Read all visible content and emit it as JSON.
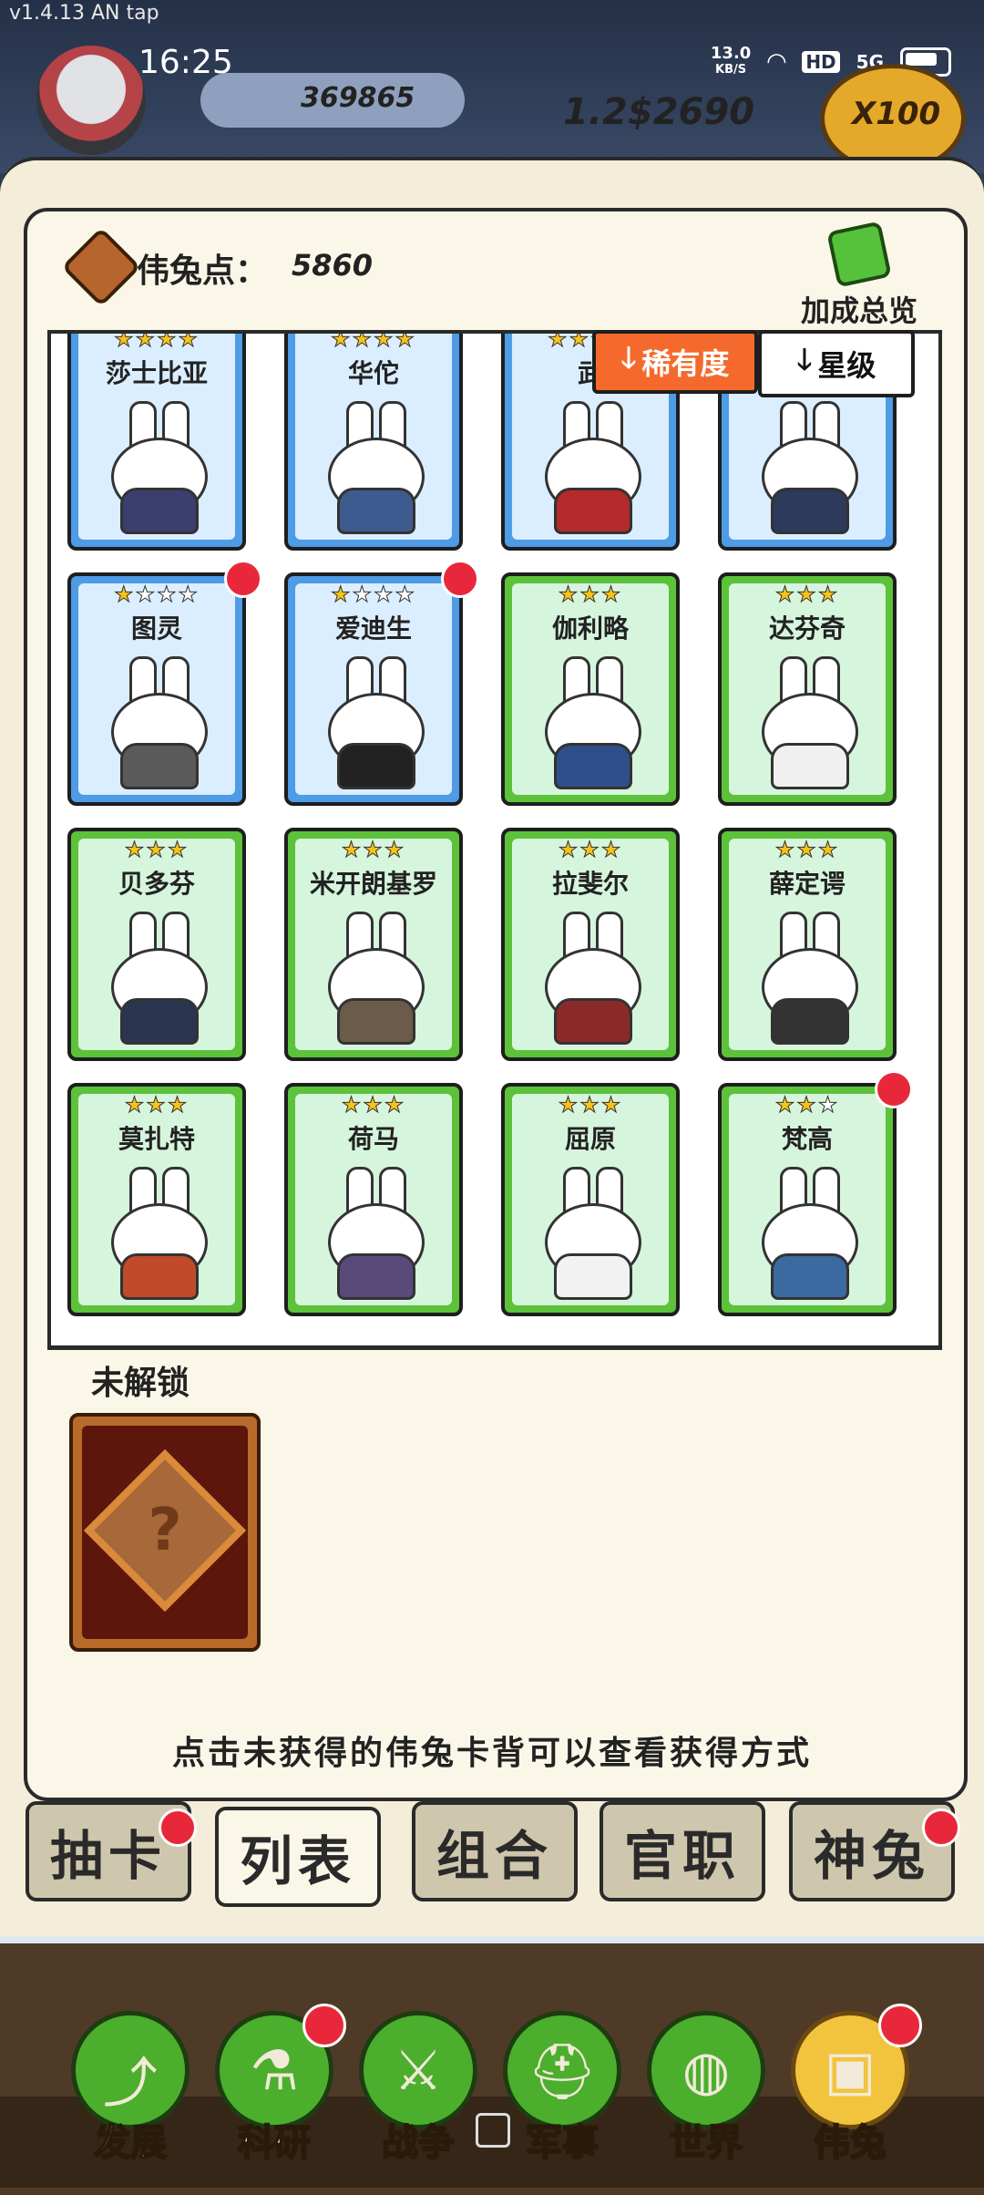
{
  "app": {
    "version": "v1.4.13 AN tap"
  },
  "status_bar": {
    "time": "16:25",
    "net_speed": "13.0",
    "net_unit": "KB/S",
    "hd": "HD",
    "signal": "5G"
  },
  "resources": {
    "silver": "369865",
    "gold": "1.2$2690",
    "multiplier": "X100"
  },
  "header": {
    "points_label": "伟兔点：",
    "points_value": "5860",
    "bonus_label": "加成总览"
  },
  "sort": {
    "rarity": "稀有度",
    "star": "星级"
  },
  "cards": [
    {
      "name": "莎士比亚",
      "rarity": "blue",
      "stars": 4,
      "filled": 4,
      "dot": false
    },
    {
      "name": "华佗",
      "rarity": "blue",
      "stars": 4,
      "filled": 4,
      "dot": false
    },
    {
      "name": "武",
      "rarity": "blue",
      "stars": 4,
      "filled": 4,
      "dot": false
    },
    {
      "name": "",
      "rarity": "blue",
      "stars": 4,
      "filled": 4,
      "dot": false
    },
    {
      "name": "图灵",
      "rarity": "blue",
      "stars": 4,
      "filled": 1,
      "dot": true
    },
    {
      "name": "爱迪生",
      "rarity": "blue",
      "stars": 4,
      "filled": 1,
      "dot": true
    },
    {
      "name": "伽利略",
      "rarity": "green",
      "stars": 3,
      "filled": 3,
      "dot": false
    },
    {
      "name": "达芬奇",
      "rarity": "green",
      "stars": 3,
      "filled": 3,
      "dot": false
    },
    {
      "name": "贝多芬",
      "rarity": "green",
      "stars": 3,
      "filled": 3,
      "dot": false
    },
    {
      "name": "米开朗基罗",
      "rarity": "green",
      "stars": 3,
      "filled": 3,
      "dot": false
    },
    {
      "name": "拉斐尔",
      "rarity": "green",
      "stars": 3,
      "filled": 3,
      "dot": false
    },
    {
      "name": "薛定谔",
      "rarity": "green",
      "stars": 3,
      "filled": 3,
      "dot": false
    },
    {
      "name": "莫扎特",
      "rarity": "green",
      "stars": 3,
      "filled": 3,
      "dot": false
    },
    {
      "name": "荷马",
      "rarity": "green",
      "stars": 3,
      "filled": 3,
      "dot": false
    },
    {
      "name": "屈原",
      "rarity": "green",
      "stars": 3,
      "filled": 3,
      "dot": false
    },
    {
      "name": "梵高",
      "rarity": "green",
      "stars": 3,
      "filled": 2,
      "dot": true
    }
  ],
  "locked": {
    "title": "未解锁",
    "placeholder": "?"
  },
  "hint": "点击未获得的伟兔卡背可以查看获得方式",
  "tabs": [
    {
      "label": "抽卡",
      "active": false,
      "dot": true
    },
    {
      "label": "列表",
      "active": true,
      "dot": false
    },
    {
      "label": "组合",
      "active": false,
      "dot": false
    },
    {
      "label": "官职",
      "active": false,
      "dot": false
    },
    {
      "label": "神兔",
      "active": false,
      "dot": true
    }
  ],
  "nav": [
    {
      "label": "发展",
      "icon": "develop-icon",
      "active": false,
      "dot": false
    },
    {
      "label": "科研",
      "icon": "flask-icon",
      "active": false,
      "dot": true
    },
    {
      "label": "战争",
      "icon": "swords-icon",
      "active": false,
      "dot": false
    },
    {
      "label": "军事",
      "icon": "helmet-icon",
      "active": false,
      "dot": false
    },
    {
      "label": "世界",
      "icon": "globe-icon",
      "active": false,
      "dot": false
    },
    {
      "label": "伟兔",
      "icon": "rabbit-book-icon",
      "active": true,
      "dot": true
    }
  ],
  "colors": {
    "blue_card": "#4e9be6",
    "green_card": "#5cc23a",
    "red_dot": "#e8283a",
    "sort_active": "#f56a2c"
  }
}
